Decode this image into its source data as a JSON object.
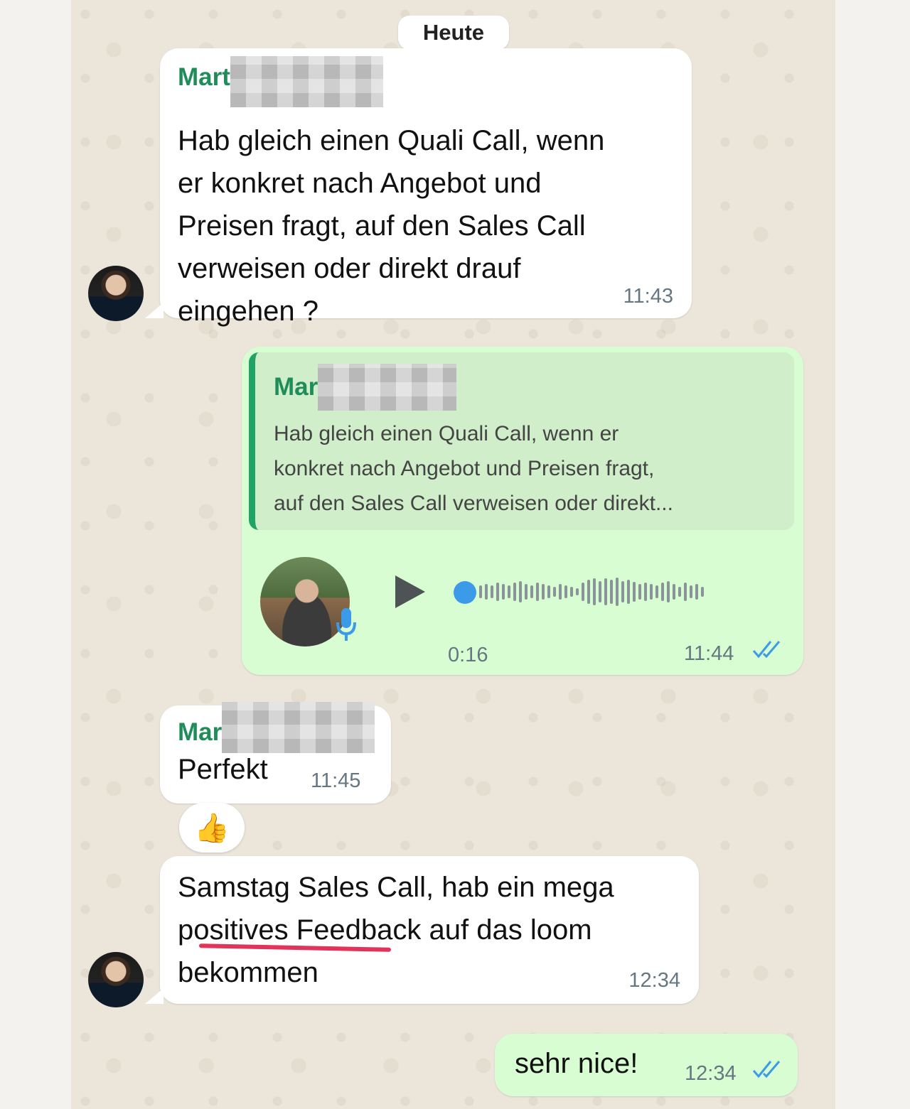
{
  "date_separator": "Heute",
  "messages": [
    {
      "direction": "incoming",
      "sender_visible": "Mart",
      "text_lines": [
        "Hab gleich einen Quali Call, wenn",
        "er konkret nach Angebot und",
        "Preisen fragt, auf den Sales Call",
        "verweisen oder direkt drauf",
        "eingehen ?"
      ],
      "time": "11:43"
    },
    {
      "direction": "outgoing",
      "type": "voice",
      "quoted": {
        "sender_visible": "Mar",
        "text_lines": [
          "Hab gleich einen Quali Call, wenn er",
          "konkret nach Angebot und Preisen fragt,",
          "auf den Sales Call verweisen oder direkt..."
        ]
      },
      "duration": "0:16",
      "time": "11:44",
      "read_receipt": "double-check-read"
    },
    {
      "direction": "incoming",
      "sender_visible": "Mar",
      "text": "Perfekt",
      "time": "11:45",
      "reaction": "👍"
    },
    {
      "direction": "incoming",
      "text_lines": [
        "Samstag Sales Call, hab ein mega",
        "positives Feedback auf das loom",
        "bekommen"
      ],
      "time": "12:34"
    },
    {
      "direction": "outgoing",
      "text": "sehr nice!",
      "time": "12:34",
      "read_receipt": "double-check-read"
    }
  ],
  "colors": {
    "wallpaper": "#ebe5da",
    "incoming_bubble": "#ffffff",
    "outgoing_bubble": "#d9fdd3",
    "sender_name": "#1f8c5a",
    "read_ticks": "#3b9be8",
    "annotation_underline": "#e0345a"
  },
  "icons": {
    "play": "play-icon",
    "mic": "microphone-icon",
    "read": "double-check-icon"
  }
}
